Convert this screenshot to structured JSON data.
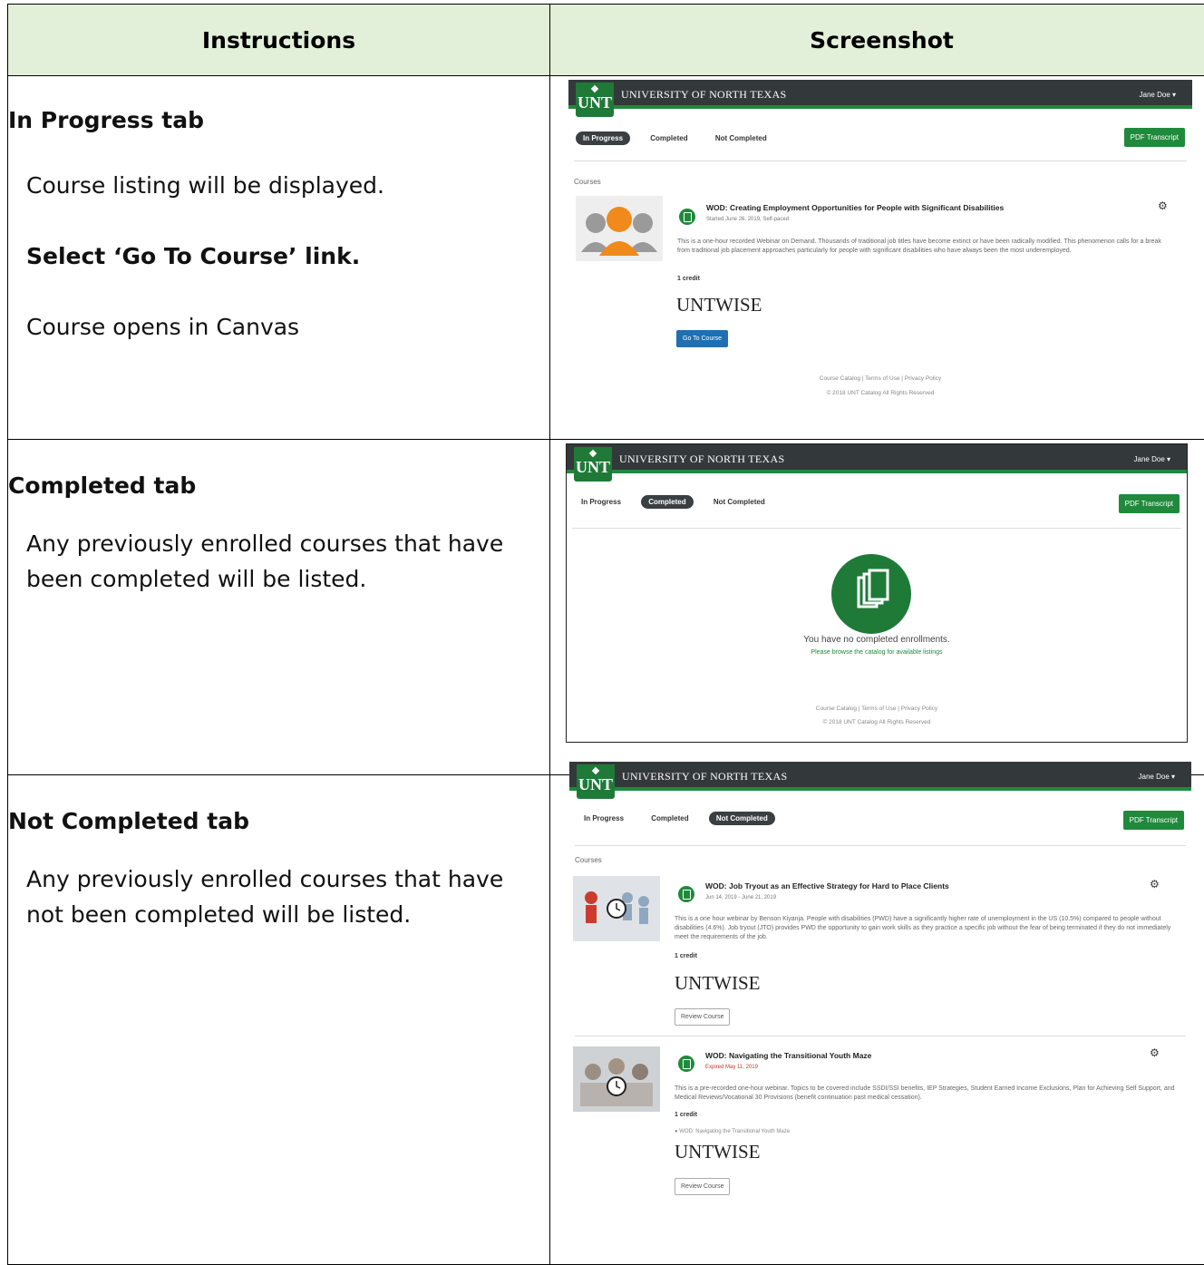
{
  "headers": {
    "instructions": "Instructions",
    "screenshot": "Screenshot"
  },
  "rows": [
    {
      "title": "In Progress tab",
      "paras": [
        "Course listing will be displayed.",
        "Select ‘Go To Course’ link.",
        "Course opens in Canvas"
      ]
    },
    {
      "title": "Completed tab",
      "paras": [
        "Any previously enrolled courses that have",
        "been completed will be listed."
      ]
    },
    {
      "title": "Not Completed tab",
      "paras": [
        "Any previously enrolled courses that have",
        "not been completed will be listed."
      ]
    }
  ],
  "ui": {
    "logo": "UNT",
    "university": "UNIVERSITY OF NORTH TEXAS",
    "user": "Jane Doe ▾",
    "tabs": [
      "In Progress",
      "Completed",
      "Not Completed"
    ],
    "pdf": "PDF Transcript",
    "courses_label": "Courses",
    "credit": "1 credit",
    "brand_a": "UNT",
    "brand_b": "WISE",
    "footer_links": "Course Catalog   |   Terms of Use   |   Privacy Policy",
    "footer_copy": "© 2018 UNT Catalog All Rights Reserved"
  },
  "shot1": {
    "course_title": "WOD: Creating Employment Opportunities for People with Significant Disabilities",
    "date": "Started June 26, 2019, Self-paced",
    "desc": "This is a one-hour recorded Webinar on Demand. Thousands of traditional job titles have become extinct or have been radically modified. This phenomenon calls for a break from traditional job placement approaches particularly for people with significant disabilities who have always been the most underemployed.",
    "button": "Go To Course"
  },
  "shot2": {
    "empty_msg": "You have no completed enrollments.",
    "browse_msg": "Please browse the catalog for available listings"
  },
  "shot3": {
    "c1_title": "WOD: Job Tryout as an Effective Strategy for Hard to Place Clients",
    "c1_date": "Jun 14, 2019 - June 21, 2019",
    "c1_desc": "This is a one hour webinar by Benson Kiyanja. People with disabilities (PWD) have a significantly higher rate of unemployment in the US (10.5%) compared to people without disabilities (4.6%). Job tryout (JTO) provides PWD the opportunity to gain work skills as they practice a specific job without the fear of being terminated if they do not immediately meet the requirements of the job.",
    "c2_title": "WOD: Navigating the Transitional Youth Maze",
    "c2_date": "Expired May 11, 2019",
    "c2_desc": "This is a pre-recorded one-hour webinar. Topics to be covered include SSDI/SSI benefits, IEP Strategies, Student Earned Income Exclusions, Plan for Achieving Self Support, and Medical Reviews/Vocational 30 Provisions (benefit continuation past medical cessation).",
    "c2_bullet": "WOD: Navigating the Transitional Youth Maze",
    "button": "Review Course"
  }
}
